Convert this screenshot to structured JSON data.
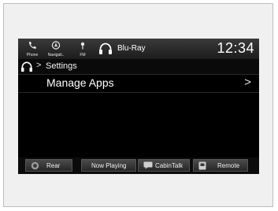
{
  "top_bar": {
    "sources": [
      {
        "label": "Phone",
        "icon": "phone-icon"
      },
      {
        "label": "Navigati..",
        "icon": "navigation-icon"
      },
      {
        "label": "FM",
        "icon": "fm-radio-icon"
      }
    ],
    "now_playing_icon": "headphones-icon",
    "now_playing_label": "Blu-Ray",
    "clock": "12:34"
  },
  "breadcrumb": {
    "icon": "headphones-icon",
    "separator": ">",
    "label": "Settings"
  },
  "menu": {
    "items": [
      {
        "label": "Manage Apps",
        "chevron": ">"
      }
    ]
  },
  "bottom_bar": {
    "buttons": [
      {
        "label": "Rear",
        "icon": "rear-icon"
      },
      {
        "label": "Now Playing",
        "icon": ""
      },
      {
        "label": "CabinTalk",
        "icon": "cabintalk-icon"
      },
      {
        "label": "Remote",
        "icon": "remote-icon"
      }
    ]
  }
}
